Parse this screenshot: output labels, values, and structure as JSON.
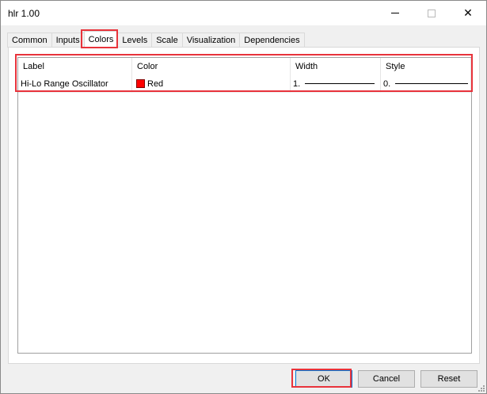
{
  "window": {
    "title": "hlr 1.00"
  },
  "tabs": [
    {
      "label": "Common"
    },
    {
      "label": "Inputs"
    },
    {
      "label": "Colors"
    },
    {
      "label": "Levels"
    },
    {
      "label": "Scale"
    },
    {
      "label": "Visualization"
    },
    {
      "label": "Dependencies"
    }
  ],
  "grid": {
    "headers": {
      "label": "Label",
      "color": "Color",
      "width": "Width",
      "style": "Style"
    },
    "rows": [
      {
        "label": "Hi-Lo Range Oscillator",
        "color_name": "Red",
        "color_hex": "#ff0000",
        "width": "1.",
        "style": "0."
      }
    ]
  },
  "buttons": {
    "ok": "OK",
    "cancel": "Cancel",
    "reset": "Reset"
  },
  "theme": {
    "highlight": "#e8333b",
    "accent": "#0078d7"
  }
}
